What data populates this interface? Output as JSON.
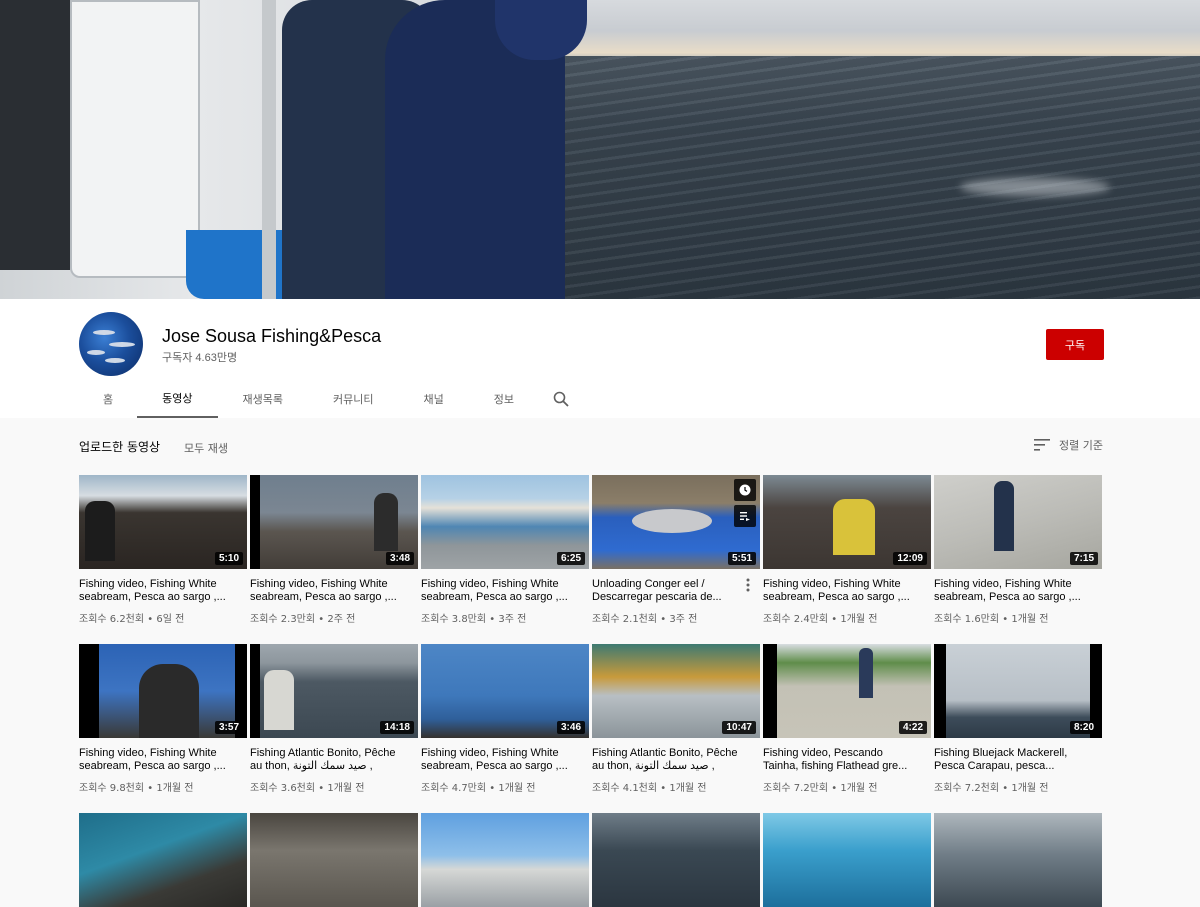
{
  "channel": {
    "name": "Jose Sousa Fishing&Pesca",
    "subscribers": "구독자 4.63만명",
    "subscribe_label": "구독"
  },
  "tabs": [
    {
      "label": "홈"
    },
    {
      "label": "동영상",
      "active": true
    },
    {
      "label": "재생목록"
    },
    {
      "label": "커뮤니티"
    },
    {
      "label": "채널"
    },
    {
      "label": "정보"
    }
  ],
  "section": {
    "title": "업로드한 동영상",
    "play_all": "모두 재생",
    "sort_label": "정렬 기준"
  },
  "videos": [
    {
      "duration": "5:10",
      "title": "Fishing video, Fishing White seabream, Pesca ao sargo ,...",
      "meta": "조회수 6.2천회 • 6일 전"
    },
    {
      "duration": "3:48",
      "title": "Fishing video, Fishing White seabream, Pesca ao sargo ,...",
      "meta": "조회수 2.3만회 • 2주 전"
    },
    {
      "duration": "6:25",
      "title": "Fishing video, Fishing White seabream, Pesca ao sargo ,...",
      "meta": "조회수 3.8만회 • 3주 전"
    },
    {
      "duration": "5:51",
      "title": "Unloading Conger eel / Descarregar pescaria de...",
      "meta": "조회수 2.1천회 • 3주 전"
    },
    {
      "duration": "12:09",
      "title": "Fishing video, Fishing White seabream, Pesca ao sargo ,...",
      "meta": "조회수 2.4만회 • 1개월 전"
    },
    {
      "duration": "7:15",
      "title": "Fishing video, Fishing White seabream, Pesca ao sargo ,...",
      "meta": "조회수 1.6만회 • 1개월 전"
    },
    {
      "duration": "3:57",
      "title": "Fishing video, Fishing White seabream, Pesca ao sargo ,...",
      "meta": "조회수 9.8천회 • 1개월 전"
    },
    {
      "duration": "14:18",
      "title": "Fishing Atlantic Bonito, Pêche au thon, صيد سمك التونة ,",
      "meta": "조회수 3.6천회 • 1개월 전"
    },
    {
      "duration": "3:46",
      "title": "Fishing video, Fishing White seabream, Pesca ao sargo ,...",
      "meta": "조회수 4.7만회 • 1개월 전"
    },
    {
      "duration": "10:47",
      "title": "Fishing Atlantic Bonito, Pêche au thon, صيد سمك التونة ,",
      "meta": "조회수 4.1천회 • 1개월 전"
    },
    {
      "duration": "4:22",
      "title": "Fishing video, Pescando Tainha, fishing Flathead gre...",
      "meta": "조회수 7.2만회 • 1개월 전"
    },
    {
      "duration": "8:20",
      "title": "Fishing Bluejack Mackerell, Pesca Carapau, pesca...",
      "meta": "조회수 7.2천회 • 1개월 전"
    },
    {
      "duration": "",
      "title": "",
      "meta": ""
    },
    {
      "duration": "",
      "title": "",
      "meta": ""
    },
    {
      "duration": "",
      "title": "",
      "meta": ""
    },
    {
      "duration": "",
      "title": "",
      "meta": ""
    },
    {
      "duration": "",
      "title": "",
      "meta": ""
    },
    {
      "duration": "",
      "title": "",
      "meta": ""
    }
  ],
  "colors": {
    "subscribe": "#cc0000",
    "page_bg": "#f9f9f9",
    "header_bg": "#ffffff",
    "meta_text": "#606060"
  }
}
